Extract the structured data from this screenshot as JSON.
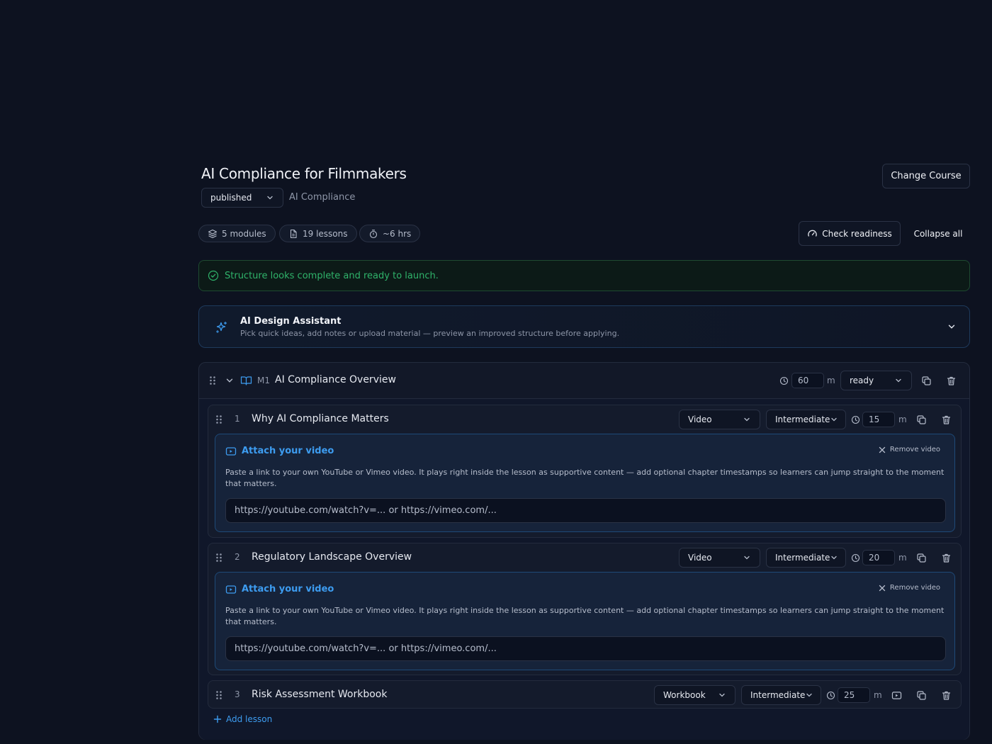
{
  "course": {
    "title": "AI Compliance for Filmmakers",
    "status": "published",
    "category": "AI Compliance",
    "change_label": "Change Course"
  },
  "stats": {
    "modules": "5 modules",
    "lessons": "19 lessons",
    "duration": "~6 hrs"
  },
  "actions": {
    "check_readiness": "Check readiness",
    "collapse_all": "Collapse all"
  },
  "readiness_message": "Structure looks complete and ready to launch.",
  "assistant": {
    "title": "AI Design Assistant",
    "subtitle": "Pick quick ideas, add notes or upload material — preview an improved structure before applying."
  },
  "module": {
    "code": "M1",
    "title": "AI Compliance Overview",
    "duration": "60",
    "unit": "m",
    "status": "ready",
    "lessons": [
      {
        "number": "1",
        "title": "Why AI Compliance Matters",
        "type": "Video",
        "level": "Intermediate",
        "duration": "15",
        "unit": "m",
        "video": {
          "title": "Attach your video",
          "remove_label": "Remove video",
          "description": "Paste a link to your own YouTube or Vimeo video. It plays right inside the lesson as supportive content — add optional chapter timestamps so learners can jump straight to the moment that matters.",
          "placeholder": "https://youtube.com/watch?v=... or https://vimeo.com/..."
        }
      },
      {
        "number": "2",
        "title": "Regulatory Landscape Overview",
        "type": "Video",
        "level": "Intermediate",
        "duration": "20",
        "unit": "m",
        "video": {
          "title": "Attach your video",
          "remove_label": "Remove video",
          "description": "Paste a link to your own YouTube or Vimeo video. It plays right inside the lesson as supportive content — add optional chapter timestamps so learners can jump straight to the moment that matters.",
          "placeholder": "https://youtube.com/watch?v=... or https://vimeo.com/..."
        }
      },
      {
        "number": "3",
        "title": "Risk Assessment Workbook",
        "type": "Workbook",
        "level": "Intermediate",
        "duration": "25",
        "unit": "m"
      }
    ],
    "add_lesson_label": "Add lesson"
  },
  "colors": {
    "background": "#0d1220",
    "accent": "#3d9cf0",
    "success": "#2fb36a"
  }
}
